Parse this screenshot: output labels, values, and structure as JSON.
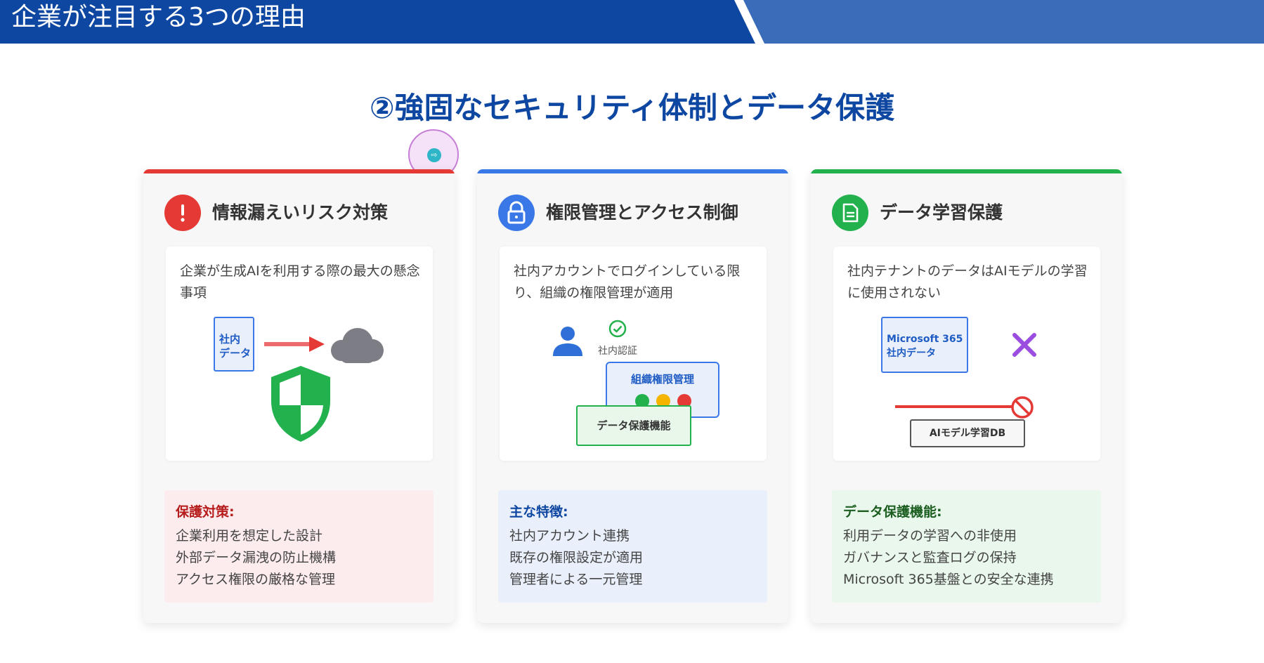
{
  "header": {
    "title": "企業が注目する3つの理由"
  },
  "section": {
    "title": "②強固なセキュリティ体制とデータ保護"
  },
  "colors": {
    "red": "#e53935",
    "blue": "#3b78e7",
    "green": "#22b14c",
    "navy": "#0d47a1"
  },
  "cards": [
    {
      "title": "情報漏えいリスク対策",
      "icon": "exclamation-icon",
      "description": "企業が生成AIを利用する際の最大の懸念事項",
      "diagram": {
        "doc_label": "社内\nデータ"
      },
      "features_title": "保護対策:",
      "features": [
        "企業利用を想定した設計",
        "外部データ漏洩の防止機構",
        "アクセス権限の厳格な管理"
      ]
    },
    {
      "title": "権限管理とアクセス制御",
      "icon": "lock-icon",
      "description": "社内アカウントでログインしている限り、組織の権限管理が適用",
      "diagram": {
        "auth_label": "社内認証",
        "org_label": "組織権限管理",
        "protect_label": "データ保護機能"
      },
      "features_title": "主な特徴:",
      "features": [
        "社内アカウント連携",
        "既存の権限設定が適用",
        "管理者による一元管理"
      ]
    },
    {
      "title": "データ学習保護",
      "icon": "document-icon",
      "description": "社内テナントのデータはAIモデルの学習に使用されない",
      "diagram": {
        "m365_label": "Microsoft 365\n社内データ",
        "db_label": "AIモデル学習DB"
      },
      "features_title": "データ保護機能:",
      "features": [
        "利用データの学習への非使用",
        "ガバナンスと監査ログの保持",
        "Microsoft 365基盤との安全な連携"
      ]
    }
  ]
}
